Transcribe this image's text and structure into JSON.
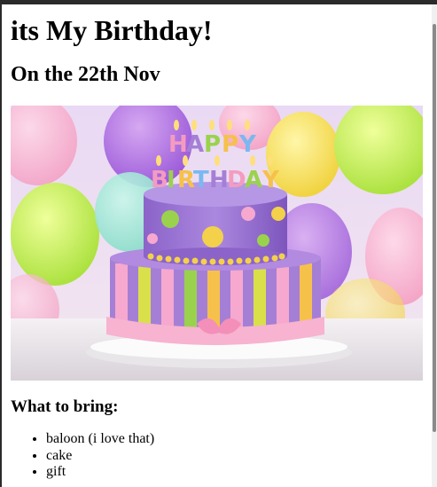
{
  "page": {
    "title": "its My Birthday!",
    "subtitle": "On the 22th Nov",
    "list_heading": "What to bring:",
    "items": [
      "baloon (i love that)",
      "cake",
      "gift"
    ]
  },
  "image": {
    "subject": "two-tier birthday cake with Happy Birthday candles and balloons",
    "candle_text": [
      "HAPPY",
      "BIRTHDAY"
    ]
  }
}
